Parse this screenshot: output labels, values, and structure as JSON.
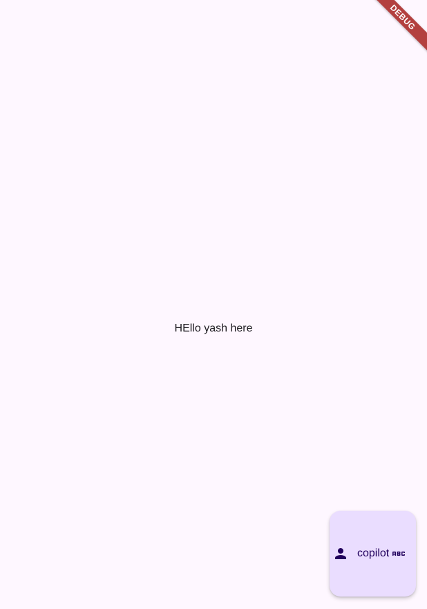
{
  "debug_banner": {
    "label": "DEBUG",
    "color": "#b3403f"
  },
  "body": {
    "message": "HEllo yash here"
  },
  "fab": {
    "label": "copilot",
    "leading_icon": "person-icon",
    "trailing_icon": "abc-icon",
    "background": "#eaddff",
    "foreground": "#21005d"
  },
  "theme": {
    "background": "#fef7ff",
    "text": "#1d1b20"
  }
}
